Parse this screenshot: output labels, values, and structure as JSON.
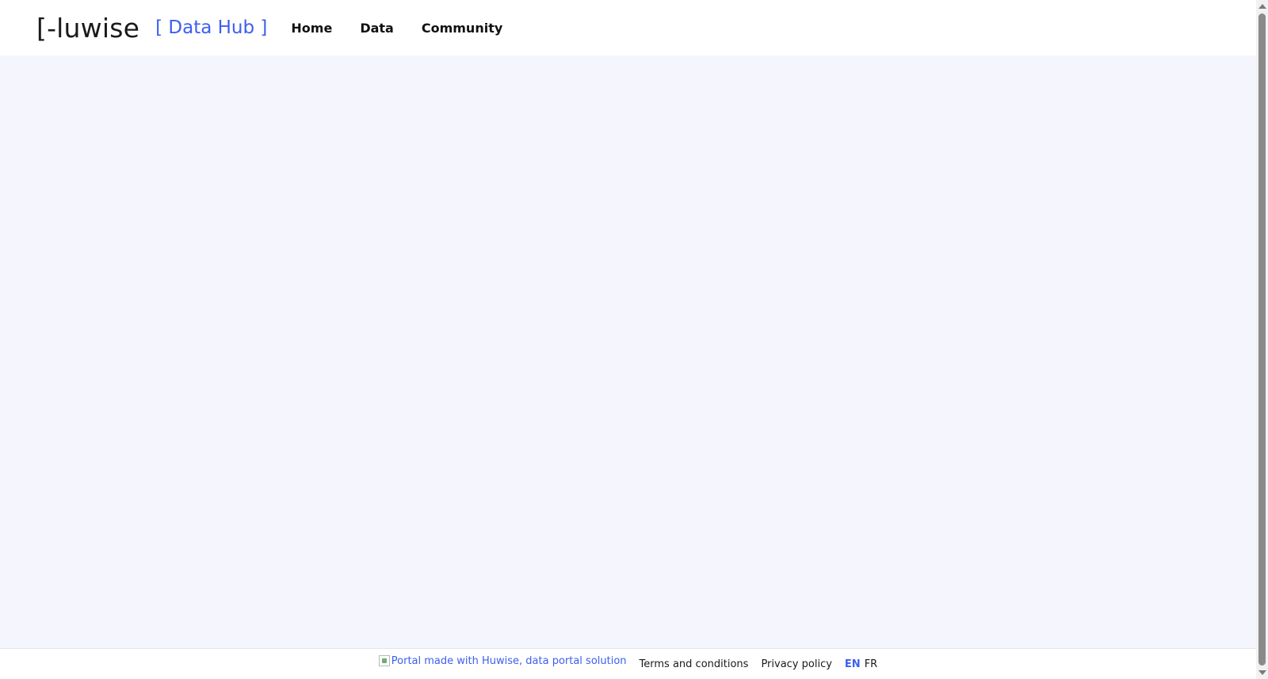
{
  "header": {
    "logo_text": "[-luwise",
    "logo_subtitle": "[ Data Hub ]",
    "nav": [
      {
        "label": "Home"
      },
      {
        "label": "Data"
      },
      {
        "label": "Community"
      }
    ]
  },
  "footer": {
    "badge_alt": "Portal made with Huwise, data portal solution",
    "terms_label": "Terms and conditions",
    "privacy_label": "Privacy policy",
    "lang_en": "EN",
    "lang_fr": "FR"
  },
  "colors": {
    "accent": "#3d5ef0",
    "page_background": "#f4f5fd",
    "header_background": "#ffffff"
  }
}
